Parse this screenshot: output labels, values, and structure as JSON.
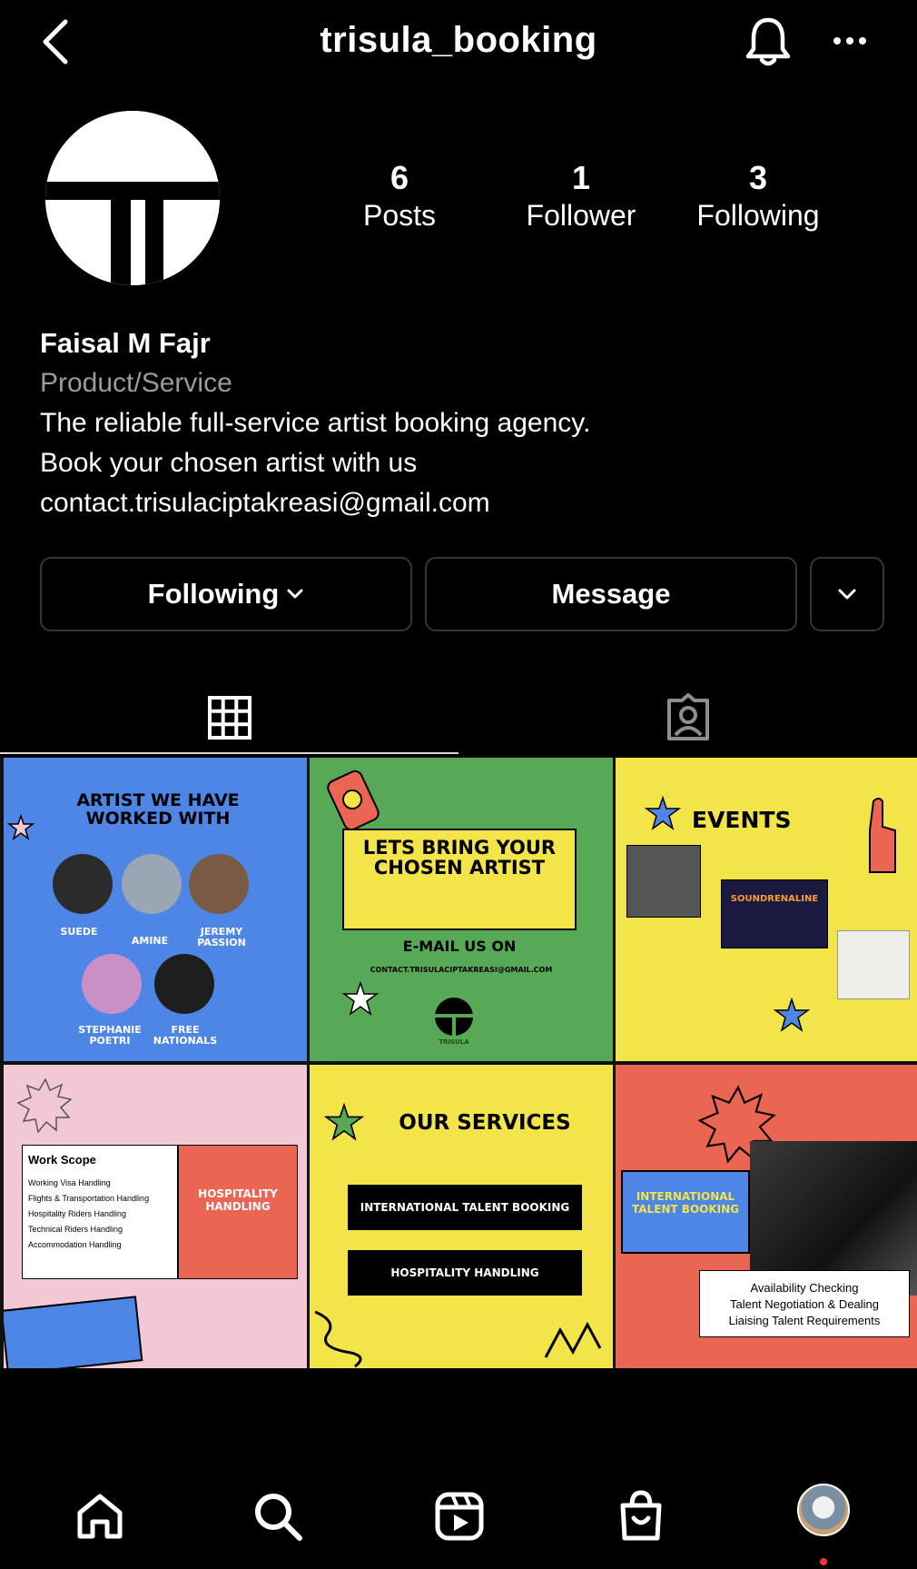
{
  "header": {
    "username": "trisula_booking",
    "icons": [
      "back-icon",
      "bell-icon",
      "more-icon"
    ]
  },
  "profile": {
    "stats": [
      {
        "value": "6",
        "label": "Posts"
      },
      {
        "value": "1",
        "label": "Follower"
      },
      {
        "value": "3",
        "label": "Following"
      }
    ],
    "name": "Faisal M Fajr",
    "category": "Product/Service",
    "bio_lines": [
      "The reliable full-service artist booking agency.",
      "Book your chosen artist with us",
      "contact.trisulaciptakreasi@gmail.com"
    ]
  },
  "actions": {
    "following_label": "Following",
    "message_label": "Message"
  },
  "tabs": {
    "icons": [
      "grid-icon",
      "tagged-icon"
    ],
    "active": "grid"
  },
  "posts": {
    "p1": {
      "title": "ARTIST WE HAVE WORKED WITH",
      "artists": [
        "SUEDE",
        "AMINE",
        "JEREMY PASSION",
        "STEPHANIE POETRI",
        "FREE NATIONALS"
      ]
    },
    "p2": {
      "title": "LETS BRING YOUR CHOSEN ARTIST",
      "subtitle": "E-MAIL US ON",
      "email": "CONTACT.TRISULACIPTAKREASI@GMAIL.COM",
      "logo_caption": "TRISULA"
    },
    "p3": {
      "title": "EVENTS",
      "flyer_caption": "SOUNDRENALINE"
    },
    "p4": {
      "scope_title": "Work Scope",
      "scope_items": [
        "Working Visa Handling",
        "Flights & Transportation Handling",
        "Hospitality Riders Handling",
        "Technical Riders Handling",
        "Accommodation Handling"
      ],
      "side_label": "HOSPITALITY HANDLING"
    },
    "p5": {
      "title": "OUR SERVICES",
      "services": [
        "INTERNATIONAL TALENT BOOKING",
        "HOSPITALITY HANDLING"
      ]
    },
    "p6": {
      "label": "INTERNATIONAL TALENT BOOKING",
      "items": [
        "Availability Checking",
        "Talent Negotiation & Dealing",
        "Liaising Talent Requirements"
      ]
    }
  },
  "bottom_nav": {
    "icons": [
      "home-icon",
      "search-icon",
      "reels-icon",
      "shop-icon",
      "profile-avatar"
    ]
  },
  "colors": {
    "background": "#000000",
    "blue_tile": "#4d86e5",
    "green_tile": "#58a956",
    "yellow_tile": "#f3e44a",
    "pink_tile": "#f2c8d4",
    "red_tile": "#ea6552",
    "notification_dot": "#ff3040"
  }
}
